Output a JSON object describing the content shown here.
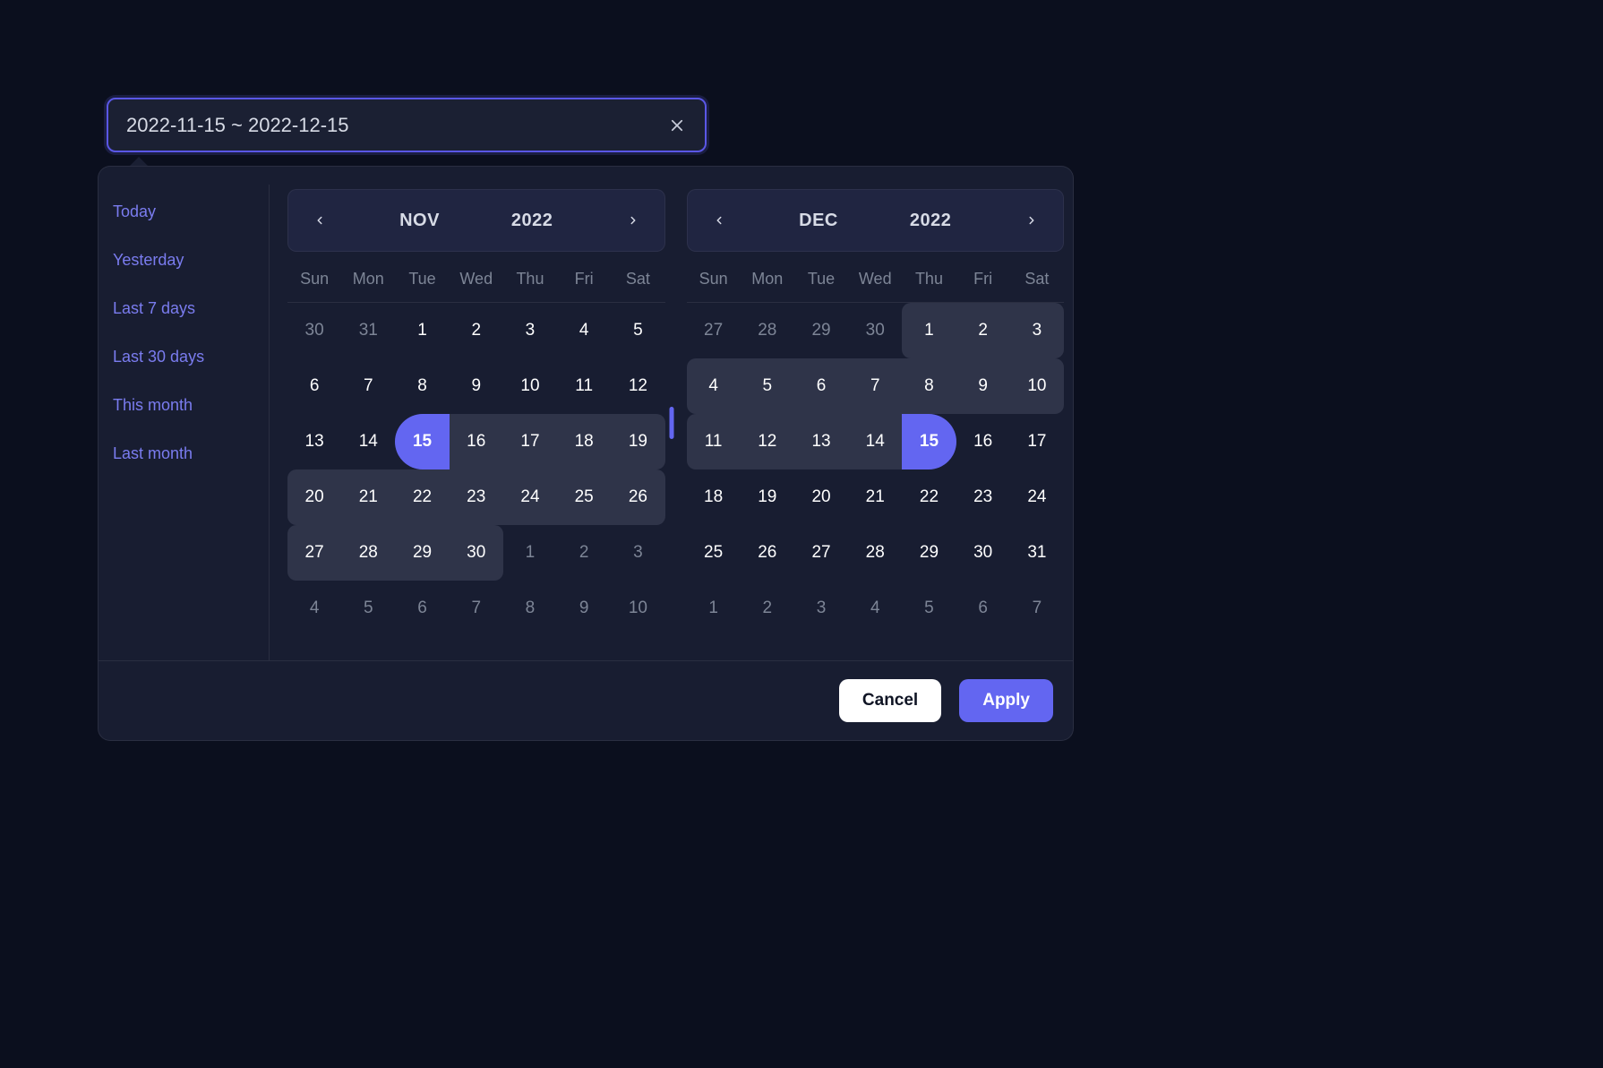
{
  "input": {
    "value": "2022-11-15 ~ 2022-12-15"
  },
  "presets": [
    {
      "label": "Today"
    },
    {
      "label": "Yesterday"
    },
    {
      "label": "Last 7 days"
    },
    {
      "label": "Last 30 days"
    },
    {
      "label": "This month"
    },
    {
      "label": "Last month"
    }
  ],
  "dow": [
    "Sun",
    "Mon",
    "Tue",
    "Wed",
    "Thu",
    "Fri",
    "Sat"
  ],
  "range": {
    "start": "2022-11-15",
    "end": "2022-12-15"
  },
  "calendars": [
    {
      "month_label": "NOV",
      "year_label": "2022",
      "year": 2022,
      "month": 11,
      "cells": [
        {
          "d": 30,
          "out": true
        },
        {
          "d": 31,
          "out": true
        },
        {
          "d": 1
        },
        {
          "d": 2
        },
        {
          "d": 3
        },
        {
          "d": 4
        },
        {
          "d": 5
        },
        {
          "d": 6
        },
        {
          "d": 7
        },
        {
          "d": 8
        },
        {
          "d": 9
        },
        {
          "d": 10
        },
        {
          "d": 11
        },
        {
          "d": 12
        },
        {
          "d": 13
        },
        {
          "d": 14
        },
        {
          "d": 15,
          "sel": "start"
        },
        {
          "d": 16,
          "r": true
        },
        {
          "d": 17,
          "r": true
        },
        {
          "d": 18,
          "r": true
        },
        {
          "d": 19,
          "r": true,
          "we": true
        },
        {
          "d": 20,
          "r": true,
          "ws": true
        },
        {
          "d": 21,
          "r": true
        },
        {
          "d": 22,
          "r": true
        },
        {
          "d": 23,
          "r": true
        },
        {
          "d": 24,
          "r": true
        },
        {
          "d": 25,
          "r": true
        },
        {
          "d": 26,
          "r": true,
          "we": true
        },
        {
          "d": 27,
          "r": true,
          "ws": true
        },
        {
          "d": 28,
          "r": true
        },
        {
          "d": 29,
          "r": true
        },
        {
          "d": 30,
          "r": true,
          "we": true
        },
        {
          "d": 1,
          "out": true
        },
        {
          "d": 2,
          "out": true
        },
        {
          "d": 3,
          "out": true
        },
        {
          "d": 4,
          "out": true
        },
        {
          "d": 5,
          "out": true
        },
        {
          "d": 6,
          "out": true
        },
        {
          "d": 7,
          "out": true
        },
        {
          "d": 8,
          "out": true
        },
        {
          "d": 9,
          "out": true
        },
        {
          "d": 10,
          "out": true
        }
      ]
    },
    {
      "month_label": "DEC",
      "year_label": "2022",
      "year": 2022,
      "month": 12,
      "cells": [
        {
          "d": 27,
          "out": true
        },
        {
          "d": 28,
          "out": true
        },
        {
          "d": 29,
          "out": true
        },
        {
          "d": 30,
          "out": true
        },
        {
          "d": 1,
          "r": true,
          "ws": true
        },
        {
          "d": 2,
          "r": true
        },
        {
          "d": 3,
          "r": true,
          "we": true
        },
        {
          "d": 4,
          "r": true,
          "ws": true
        },
        {
          "d": 5,
          "r": true
        },
        {
          "d": 6,
          "r": true
        },
        {
          "d": 7,
          "r": true
        },
        {
          "d": 8,
          "r": true
        },
        {
          "d": 9,
          "r": true
        },
        {
          "d": 10,
          "r": true,
          "we": true
        },
        {
          "d": 11,
          "r": true,
          "ws": true
        },
        {
          "d": 12,
          "r": true
        },
        {
          "d": 13,
          "r": true
        },
        {
          "d": 14,
          "r": true
        },
        {
          "d": 15,
          "sel": "end"
        },
        {
          "d": 16
        },
        {
          "d": 17
        },
        {
          "d": 18
        },
        {
          "d": 19
        },
        {
          "d": 20
        },
        {
          "d": 21
        },
        {
          "d": 22
        },
        {
          "d": 23
        },
        {
          "d": 24
        },
        {
          "d": 25
        },
        {
          "d": 26
        },
        {
          "d": 27
        },
        {
          "d": 28
        },
        {
          "d": 29
        },
        {
          "d": 30
        },
        {
          "d": 31
        },
        {
          "d": 1,
          "out": true
        },
        {
          "d": 2,
          "out": true
        },
        {
          "d": 3,
          "out": true
        },
        {
          "d": 4,
          "out": true
        },
        {
          "d": 5,
          "out": true
        },
        {
          "d": 6,
          "out": true
        },
        {
          "d": 7,
          "out": true
        }
      ]
    }
  ],
  "footer": {
    "cancel": "Cancel",
    "apply": "Apply"
  }
}
